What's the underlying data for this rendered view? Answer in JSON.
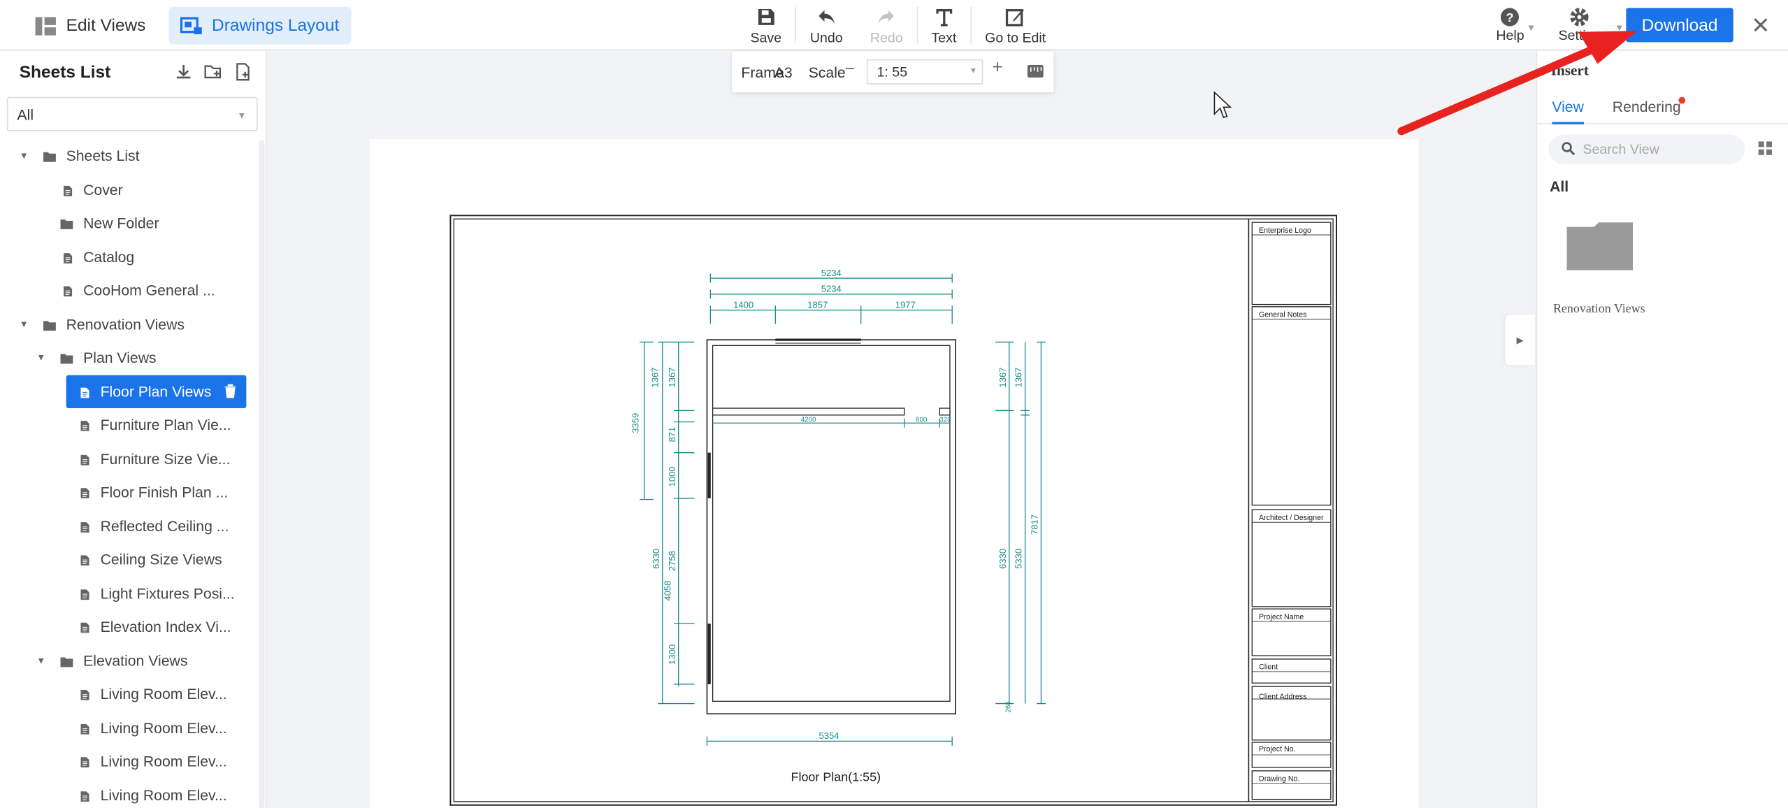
{
  "topbar": {
    "mode_edit": "Edit Views",
    "mode_layout": "Drawings Layout",
    "save": "Save",
    "undo": "Undo",
    "redo": "Redo",
    "text": "Text",
    "go_to_edit": "Go to Edit",
    "help": "Help",
    "settings": "Setting",
    "download": "Download"
  },
  "left": {
    "title": "Sheets List",
    "filter": "All",
    "tree": [
      {
        "label": "Sheets List",
        "type": "folder",
        "level": 0,
        "expanded": true
      },
      {
        "label": "Cover",
        "type": "file",
        "level": 1
      },
      {
        "label": "New Folder",
        "type": "folder",
        "level": 1
      },
      {
        "label": "Catalog",
        "type": "file",
        "level": 1
      },
      {
        "label": "CooHom General ...",
        "type": "file",
        "level": 1
      },
      {
        "label": "Renovation Views",
        "type": "folder",
        "level": 0,
        "expanded": true
      },
      {
        "label": "Plan Views",
        "type": "folder",
        "level": 1,
        "expanded": true
      },
      {
        "label": "Floor Plan Views",
        "type": "file",
        "level": 2,
        "selected": true
      },
      {
        "label": "Furniture Plan Vie...",
        "type": "file",
        "level": 2
      },
      {
        "label": "Furniture Size Vie...",
        "type": "file",
        "level": 2
      },
      {
        "label": "Floor Finish Plan ...",
        "type": "file",
        "level": 2
      },
      {
        "label": "Reflected Ceiling ...",
        "type": "file",
        "level": 2
      },
      {
        "label": "Ceiling Size Views",
        "type": "file",
        "level": 2
      },
      {
        "label": "Light Fixtures Posi...",
        "type": "file",
        "level": 2
      },
      {
        "label": "Elevation Index Vi...",
        "type": "file",
        "level": 2
      },
      {
        "label": "Elevation Views",
        "type": "folder",
        "level": 1,
        "expanded": true
      },
      {
        "label": "Living Room Elev...",
        "type": "file",
        "level": 2
      },
      {
        "label": "Living Room Elev...",
        "type": "file",
        "level": 2
      },
      {
        "label": "Living Room Elev...",
        "type": "file",
        "level": 2
      },
      {
        "label": "Living Room Elev...",
        "type": "file",
        "level": 2
      }
    ]
  },
  "scalebar": {
    "frame_label": "Frame",
    "frame_value": "A3",
    "scale_label": "Scale",
    "scale_value": "1: 55"
  },
  "drawing": {
    "caption": "Floor Plan(1:55)",
    "dims_top": [
      "5234",
      "5234",
      "1400",
      "1857",
      "1977"
    ],
    "dim_inner": "4200",
    "dim_inner_small": [
      "800",
      "328"
    ],
    "dims_left": [
      "1367",
      "1367",
      "3359",
      "871",
      "1000",
      "6330",
      "2758",
      "4058",
      "1300"
    ],
    "dims_right": [
      "1367",
      "1367",
      "7817",
      "6330",
      "5330",
      "268"
    ],
    "dim_bottom": "5354",
    "title_block": [
      "Enterprise Logo",
      "General Notes",
      "Architect / Designer",
      "Project Name",
      "Client",
      "Client Address",
      "Project No.",
      "Drawing No."
    ]
  },
  "right": {
    "insert": "Insert",
    "tab_view": "View",
    "tab_rendering": "Rendering",
    "search_placeholder": "Search View",
    "all": "All",
    "folder_label": "Renovation Views"
  },
  "colors": {
    "accent": "#1a73e8",
    "dimension": "#1a8a8a",
    "arrow": "#e8231f"
  }
}
